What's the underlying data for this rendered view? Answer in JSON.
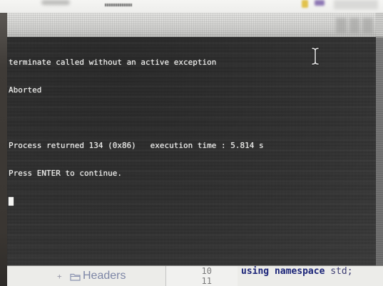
{
  "terminal": {
    "exception_message": "terminate called without an active exception",
    "abort_message": "Aborted",
    "process_status": "Process returned 134 (0x86)   execution time : 5.814 s",
    "continue_prompt": "Press ENTER to continue."
  },
  "ide": {
    "project_tree": {
      "expander": "+",
      "folder_label": "Headers"
    },
    "editor": {
      "lines": [
        {
          "number": "10",
          "keywords": "using namespace",
          "identifier": "std;"
        },
        {
          "number": "11"
        }
      ]
    }
  },
  "icons": {
    "mouse_pointer": "i-beam-cursor-icon",
    "project_folder": "folder-icon",
    "taskbar_icon_1": "yellow-app-icon",
    "taskbar_icon_2": "purple-app-icon"
  },
  "colors": {
    "terminal_bg": "#353535",
    "terminal_fg": "#f4f4f2",
    "ide_bg": "#ecece9",
    "code_keyword": "#1b2478",
    "code_identifier": "#3d3d72",
    "tree_label": "#7d86a6",
    "line_number": "#7a7a7a"
  }
}
